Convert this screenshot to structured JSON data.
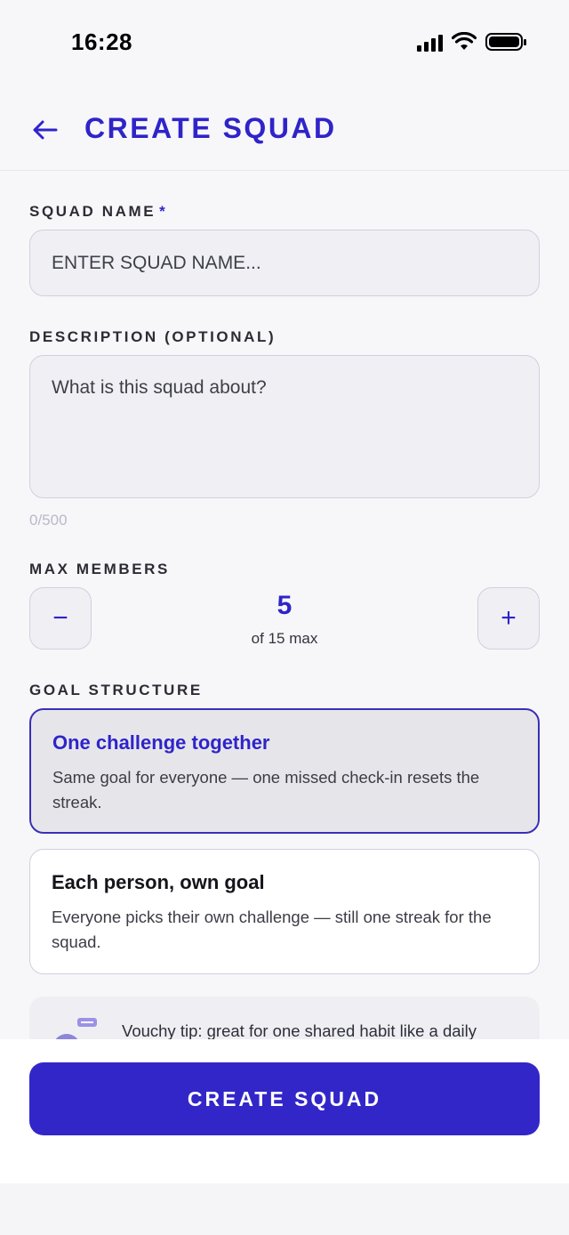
{
  "status_bar": {
    "time": "16:28"
  },
  "header": {
    "title": "CREATE SQUAD"
  },
  "squad_name": {
    "label": "SQUAD NAME",
    "required_mark": "*",
    "placeholder": "ENTER SQUAD NAME...",
    "value": ""
  },
  "description": {
    "label": "DESCRIPTION (OPTIONAL)",
    "placeholder": "What is this squad about?",
    "value": "",
    "counter": "0/500"
  },
  "max_members": {
    "label": "MAX MEMBERS",
    "decrement_label": "−",
    "increment_label": "+",
    "value": "5",
    "subtext": "of 15 max"
  },
  "goal_structure": {
    "label": "GOAL STRUCTURE",
    "options": [
      {
        "title": "One challenge together",
        "description": "Same goal for everyone — one missed check-in resets the streak.",
        "selected": true
      },
      {
        "title": "Each person, own goal",
        "description": "Everyone picks their own challenge — still one streak for the squad.",
        "selected": false
      }
    ]
  },
  "tip": {
    "text": "Vouchy tip: great for one shared habit like a daily"
  },
  "footer": {
    "create_button_label": "CREATE SQUAD"
  },
  "colors": {
    "accent": "#2f24c9",
    "background": "#f7f7fa",
    "field_background": "#f0f0f4",
    "field_border": "#cfd0de"
  }
}
